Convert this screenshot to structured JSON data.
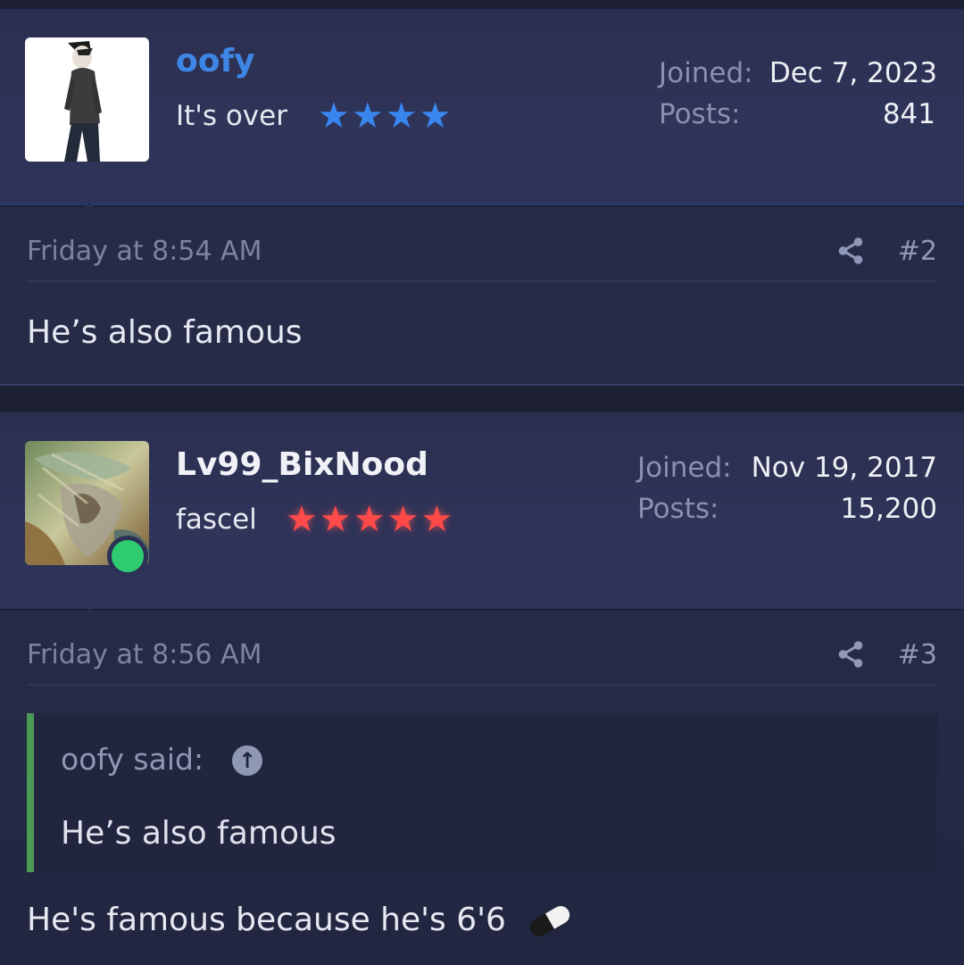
{
  "posts": [
    {
      "username": "oofy",
      "user_title": "It's over",
      "star_count": 4,
      "star_color": "#3a86f0",
      "joined_label": "Joined:",
      "joined_value": "Dec 7, 2023",
      "posts_label": "Posts:",
      "posts_value": "841",
      "timestamp": "Friday at 8:54 AM",
      "post_number": "#2",
      "body": "He’s also famous"
    },
    {
      "username": "Lv99_BixNood",
      "user_title": "fascel",
      "star_count": 5,
      "star_color": "#ff4a4a",
      "online": true,
      "joined_label": "Joined:",
      "joined_value": "Nov 19, 2017",
      "posts_label": "Posts:",
      "posts_value": "15,200",
      "timestamp": "Friday at 8:56 AM",
      "post_number": "#3",
      "quote": {
        "author_line": "oofy said:",
        "text": "He’s also famous"
      },
      "body": "He's famous because he's 6'6"
    }
  ],
  "icons": {
    "share": "share-icon",
    "quote_jump": "arrow-up-circle-icon",
    "pill": "pill-emoji-icon",
    "star": "star-icon"
  }
}
